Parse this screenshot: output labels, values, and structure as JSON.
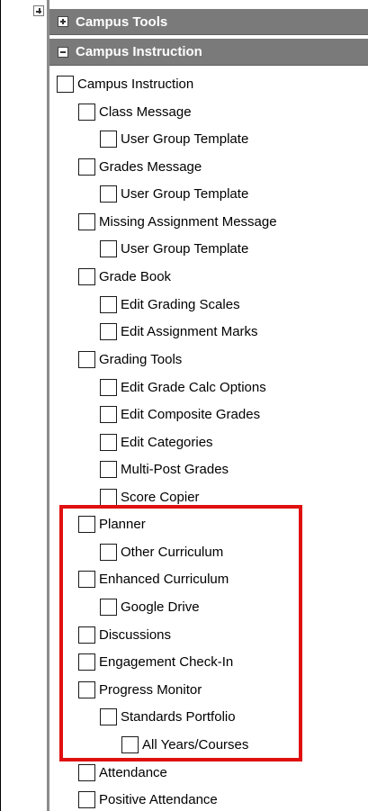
{
  "sections": {
    "tools": {
      "label": "Campus Tools",
      "state": "collapsed"
    },
    "instruction": {
      "label": "Campus Instruction",
      "state": "expanded"
    }
  },
  "tree": {
    "campus_instruction": "Campus Instruction",
    "class_message": "Class Message",
    "class_message_template": "User Group Template",
    "grades_message": "Grades Message",
    "grades_message_template": "User Group Template",
    "missing_assignment_message": "Missing Assignment Message",
    "missing_assignment_template": "User Group Template",
    "grade_book": "Grade Book",
    "edit_grading_scales": "Edit Grading Scales",
    "edit_assignment_marks": "Edit Assignment Marks",
    "grading_tools": "Grading Tools",
    "edit_grade_calc_options": "Edit Grade Calc Options",
    "edit_composite_grades": "Edit Composite Grades",
    "edit_categories": "Edit Categories",
    "multi_post_grades": "Multi-Post Grades",
    "score_copier": "Score Copier",
    "planner": "Planner",
    "other_curriculum": "Other Curriculum",
    "enhanced_curriculum": "Enhanced Curriculum",
    "google_drive": "Google Drive",
    "discussions": "Discussions",
    "engagement_check_in": "Engagement Check-In",
    "progress_monitor": "Progress Monitor",
    "standards_portfolio": "Standards Portfolio",
    "all_years_courses": "All Years/Courses",
    "attendance": "Attendance",
    "positive_attendance": "Positive Attendance"
  },
  "colors": {
    "header_bg": "#7a7a7a",
    "highlight": "#e01010"
  }
}
